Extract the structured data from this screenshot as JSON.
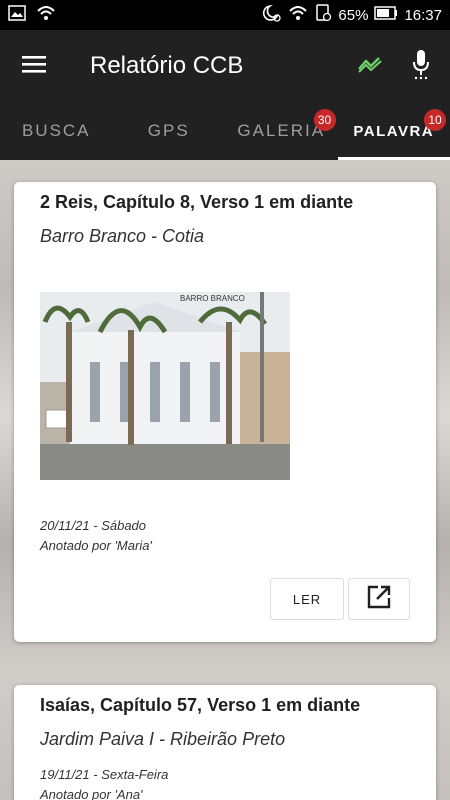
{
  "status_bar": {
    "battery": "65%",
    "time": "16:37",
    "icons": [
      "image-icon",
      "wifi-icon",
      "moon-icon",
      "wifi-signal-icon",
      "sim-icon",
      "battery-icon"
    ]
  },
  "app_bar": {
    "title": "Relatório CCB",
    "icons": [
      "menu-icon",
      "trend-icon",
      "mic-icon"
    ],
    "trend_color": "#6fcf6a"
  },
  "tabs": [
    {
      "label": "BUSCA",
      "badge": ""
    },
    {
      "label": "GPS",
      "badge": ""
    },
    {
      "label": "GALERIA",
      "badge": "30"
    },
    {
      "label": "PALAVRA",
      "badge": "10",
      "active": true
    }
  ],
  "cards": [
    {
      "title": "2 Reis, Capítulo 8, Verso 1 em diante",
      "subtitle": "Barro Branco - Cotia",
      "photo_label": "BARRO BRANCO",
      "date": "20/11/21 - Sábado",
      "author": "Anotado por 'Maria'",
      "read_label": "LER"
    },
    {
      "title": "Isaías, Capítulo 57, Verso 1 em diante",
      "subtitle": "Jardim Paiva I - Ribeirão Preto",
      "date": "19/11/21 - Sexta-Feira",
      "author": "Anotado por 'Ana'"
    }
  ],
  "colors": {
    "app_bar": "#212121",
    "badge": "#c62828",
    "trend": "#6fcf6a"
  }
}
